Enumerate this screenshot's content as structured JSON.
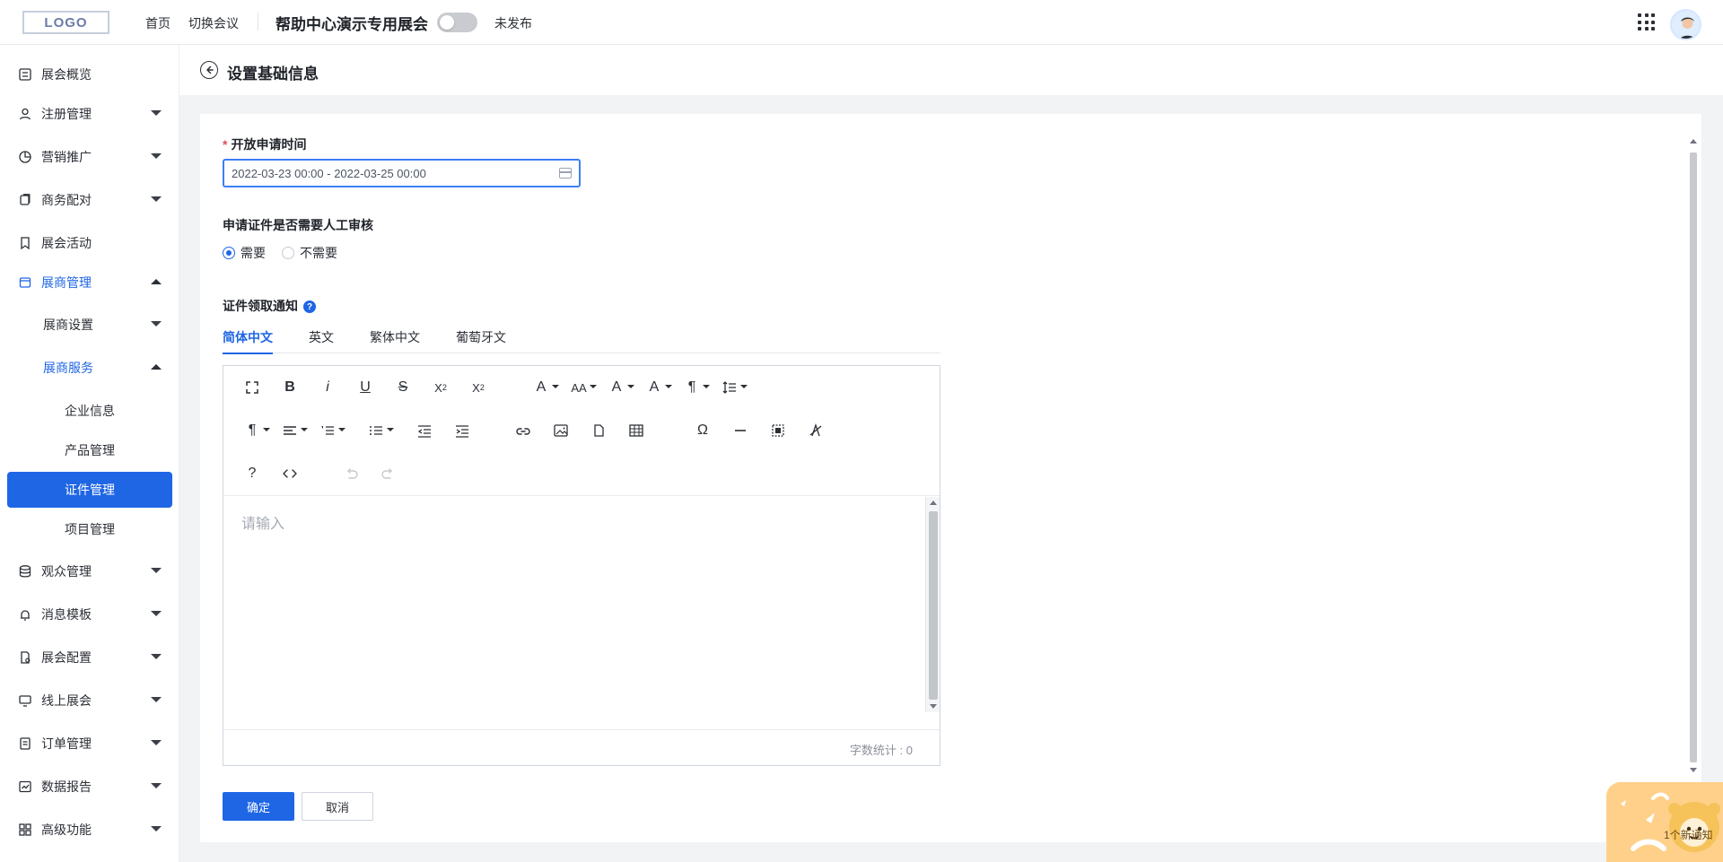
{
  "top": {
    "logo": "LOGO",
    "links": [
      "首页",
      "切换会议"
    ],
    "expo_title": "帮助中心演示专用展会",
    "publish_status": "未发布"
  },
  "sidebar": {
    "items": [
      {
        "label": "展会概览",
        "icon": "dashboard-icon",
        "expandable": false
      },
      {
        "label": "注册管理",
        "icon": "user-icon",
        "expandable": true,
        "expanded": false
      },
      {
        "label": "营销推广",
        "icon": "pie-icon",
        "expandable": true,
        "expanded": false
      },
      {
        "label": "商务配对",
        "icon": "copy-icon",
        "expandable": true,
        "expanded": false
      },
      {
        "label": "展会活动",
        "icon": "bookmark-icon",
        "expandable": false
      },
      {
        "label": "展商管理",
        "icon": "store-icon",
        "expandable": true,
        "expanded": true
      },
      {
        "label": "展商设置",
        "expandable": true,
        "expanded": false
      },
      {
        "label": "展商服务",
        "expandable": true,
        "expanded": true
      },
      {
        "label": "企业信息"
      },
      {
        "label": "产品管理"
      },
      {
        "label": "证件管理",
        "selected": true
      },
      {
        "label": "项目管理"
      },
      {
        "label": "观众管理",
        "icon": "stack-icon",
        "expandable": true,
        "expanded": false
      },
      {
        "label": "消息模板",
        "icon": "bell-icon",
        "expandable": true,
        "expanded": false
      },
      {
        "label": "展会配置",
        "icon": "settings-file-icon",
        "expandable": true,
        "expanded": false
      },
      {
        "label": "线上展会",
        "icon": "monitor-icon",
        "expandable": true,
        "expanded": false
      },
      {
        "label": "订单管理",
        "icon": "order-icon",
        "expandable": true,
        "expanded": false
      },
      {
        "label": "数据报告",
        "icon": "chart-icon",
        "expandable": true,
        "expanded": false
      },
      {
        "label": "高级功能",
        "icon": "grid-icon",
        "expandable": true,
        "expanded": false
      }
    ]
  },
  "page": {
    "title": "设置基础信息",
    "open_time_label": "开放申请时间",
    "date_value": "2022-03-23 00:00 - 2022-03-25 00:00",
    "manual_review_label": "申请证件是否需要人工审核",
    "radio_need": "需要",
    "radio_no_need": "不需要",
    "notify_label": "证件领取通知",
    "tabs": [
      "简体中文",
      "英文",
      "繁体中文",
      "葡萄牙文"
    ],
    "editor_placeholder": "请输入",
    "word_count": "字数统计 : 0",
    "confirm": "确定",
    "cancel": "取消"
  },
  "widget": {
    "notify_text": "1个新通知"
  }
}
